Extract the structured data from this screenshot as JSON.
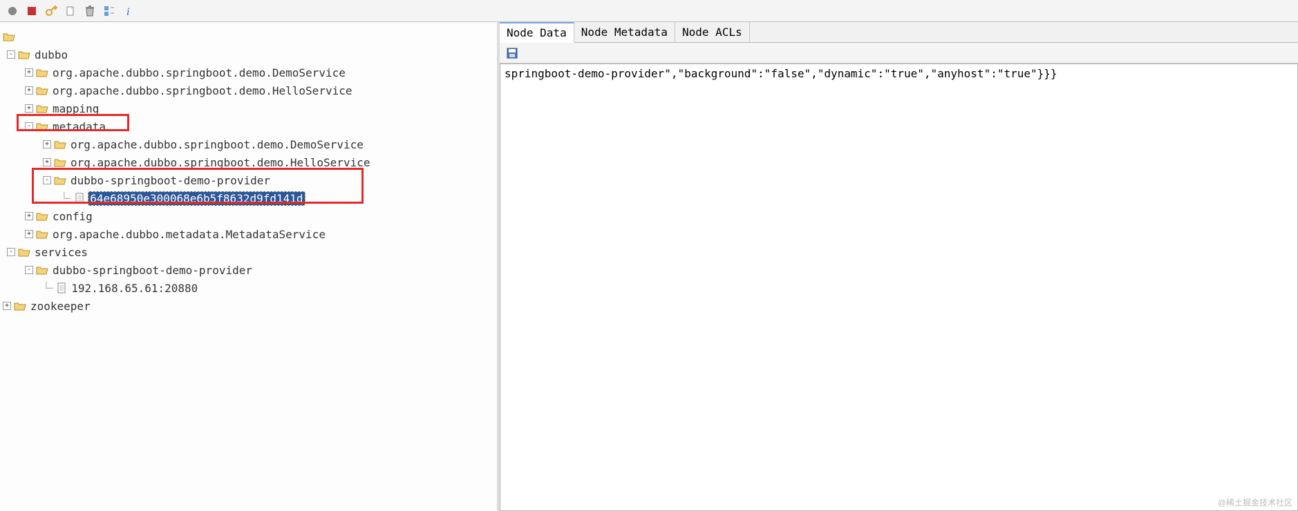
{
  "toolbar": {
    "icons": [
      "connect",
      "stop",
      "key",
      "new",
      "delete",
      "refresh-tree",
      "info"
    ]
  },
  "tree": {
    "root": {
      "dubbo": {
        "label": "dubbo",
        "children": {
          "demoService": "org.apache.dubbo.springboot.demo.DemoService",
          "helloService": "org.apache.dubbo.springboot.demo.HelloService",
          "mapping": "mapping",
          "metadata": {
            "label": "metadata",
            "children": {
              "demoService": "org.apache.dubbo.springboot.demo.DemoService",
              "helloService": "org.apache.dubbo.springboot.demo.HelloService",
              "provider": {
                "label": "dubbo-springboot-demo-provider",
                "hash": "64e68950e300068e6b5f8632d9fd141d"
              }
            }
          },
          "config": "config",
          "metadataService": "org.apache.dubbo.metadata.MetadataService"
        }
      },
      "services": {
        "label": "services",
        "children": {
          "provider": {
            "label": "dubbo-springboot-demo-provider",
            "address": "192.168.65.61:20880"
          }
        }
      },
      "zookeeper": "zookeeper"
    }
  },
  "tabs": {
    "nodeData": "Node Data",
    "nodeMetadata": "Node Metadata",
    "nodeAcls": "Node ACLs"
  },
  "nodeDataContent": "springboot-demo-provider\",\"background\":\"false\",\"dynamic\":\"true\",\"anyhost\":\"true\"}}}",
  "watermark": "@稀土掘金技术社区"
}
